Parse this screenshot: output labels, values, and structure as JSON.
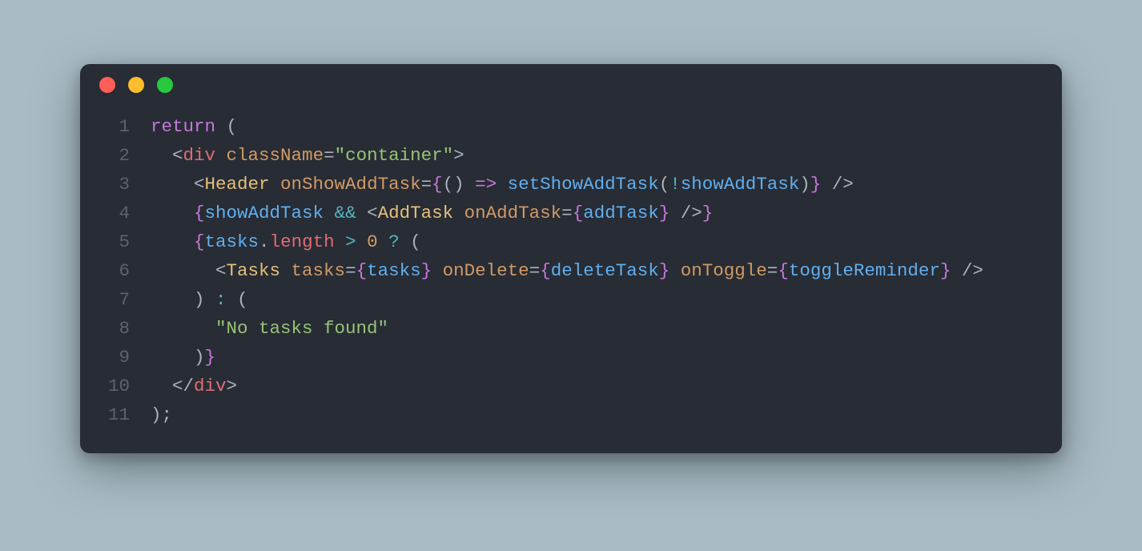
{
  "colors": {
    "page_bg": "#a9bcc6",
    "window_bg": "#282c34",
    "red": "#ff5f56",
    "yellow": "#ffbd2e",
    "green": "#27c93f"
  },
  "code": {
    "lines": [
      {
        "n": "1",
        "tokens": [
          {
            "cls": "tok-keyword",
            "t": "return"
          },
          {
            "cls": "tok-punct",
            "t": " ("
          }
        ]
      },
      {
        "n": "2",
        "tokens": [
          {
            "cls": "tok-punct",
            "t": "  <"
          },
          {
            "cls": "tok-tag",
            "t": "div"
          },
          {
            "cls": "tok-punct",
            "t": " "
          },
          {
            "cls": "tok-attr",
            "t": "className"
          },
          {
            "cls": "tok-punct",
            "t": "="
          },
          {
            "cls": "tok-string",
            "t": "\"container\""
          },
          {
            "cls": "tok-punct",
            "t": ">"
          }
        ]
      },
      {
        "n": "3",
        "tokens": [
          {
            "cls": "tok-punct",
            "t": "    <"
          },
          {
            "cls": "tok-comp",
            "t": "Header"
          },
          {
            "cls": "tok-punct",
            "t": " "
          },
          {
            "cls": "tok-attr",
            "t": "onShowAddTask"
          },
          {
            "cls": "tok-punct",
            "t": "="
          },
          {
            "cls": "tok-brace",
            "t": "{"
          },
          {
            "cls": "tok-punct",
            "t": "() "
          },
          {
            "cls": "tok-arrow",
            "t": "=>"
          },
          {
            "cls": "tok-punct",
            "t": " "
          },
          {
            "cls": "tok-func",
            "t": "setShowAddTask"
          },
          {
            "cls": "tok-punct",
            "t": "("
          },
          {
            "cls": "tok-op",
            "t": "!"
          },
          {
            "cls": "tok-var",
            "t": "showAddTask"
          },
          {
            "cls": "tok-punct",
            "t": ")"
          },
          {
            "cls": "tok-brace",
            "t": "}"
          },
          {
            "cls": "tok-punct",
            "t": " />"
          }
        ]
      },
      {
        "n": "4",
        "tokens": [
          {
            "cls": "tok-punct",
            "t": "    "
          },
          {
            "cls": "tok-brace",
            "t": "{"
          },
          {
            "cls": "tok-var",
            "t": "showAddTask"
          },
          {
            "cls": "tok-punct",
            "t": " "
          },
          {
            "cls": "tok-op",
            "t": "&&"
          },
          {
            "cls": "tok-punct",
            "t": " <"
          },
          {
            "cls": "tok-comp",
            "t": "AddTask"
          },
          {
            "cls": "tok-punct",
            "t": " "
          },
          {
            "cls": "tok-attr",
            "t": "onAddTask"
          },
          {
            "cls": "tok-punct",
            "t": "="
          },
          {
            "cls": "tok-brace",
            "t": "{"
          },
          {
            "cls": "tok-var",
            "t": "addTask"
          },
          {
            "cls": "tok-brace",
            "t": "}"
          },
          {
            "cls": "tok-punct",
            "t": " />"
          },
          {
            "cls": "tok-brace",
            "t": "}"
          }
        ]
      },
      {
        "n": "5",
        "tokens": [
          {
            "cls": "tok-punct",
            "t": "    "
          },
          {
            "cls": "tok-brace",
            "t": "{"
          },
          {
            "cls": "tok-var",
            "t": "tasks"
          },
          {
            "cls": "tok-punct",
            "t": "."
          },
          {
            "cls": "tok-prop",
            "t": "length"
          },
          {
            "cls": "tok-punct",
            "t": " "
          },
          {
            "cls": "tok-op",
            "t": ">"
          },
          {
            "cls": "tok-punct",
            "t": " "
          },
          {
            "cls": "tok-num",
            "t": "0"
          },
          {
            "cls": "tok-punct",
            "t": " "
          },
          {
            "cls": "tok-op",
            "t": "?"
          },
          {
            "cls": "tok-punct",
            "t": " ("
          }
        ]
      },
      {
        "n": "6",
        "tokens": [
          {
            "cls": "tok-punct",
            "t": "      <"
          },
          {
            "cls": "tok-comp",
            "t": "Tasks"
          },
          {
            "cls": "tok-punct",
            "t": " "
          },
          {
            "cls": "tok-attr",
            "t": "tasks"
          },
          {
            "cls": "tok-punct",
            "t": "="
          },
          {
            "cls": "tok-brace",
            "t": "{"
          },
          {
            "cls": "tok-var",
            "t": "tasks"
          },
          {
            "cls": "tok-brace",
            "t": "}"
          },
          {
            "cls": "tok-punct",
            "t": " "
          },
          {
            "cls": "tok-attr",
            "t": "onDelete"
          },
          {
            "cls": "tok-punct",
            "t": "="
          },
          {
            "cls": "tok-brace",
            "t": "{"
          },
          {
            "cls": "tok-var",
            "t": "deleteTask"
          },
          {
            "cls": "tok-brace",
            "t": "}"
          },
          {
            "cls": "tok-punct",
            "t": " "
          },
          {
            "cls": "tok-attr",
            "t": "onToggle"
          },
          {
            "cls": "tok-punct",
            "t": "="
          },
          {
            "cls": "tok-brace",
            "t": "{"
          },
          {
            "cls": "tok-var",
            "t": "toggleReminder"
          },
          {
            "cls": "tok-brace",
            "t": "}"
          },
          {
            "cls": "tok-punct",
            "t": " />"
          }
        ]
      },
      {
        "n": "7",
        "tokens": [
          {
            "cls": "tok-punct",
            "t": "    ) "
          },
          {
            "cls": "tok-op",
            "t": ":"
          },
          {
            "cls": "tok-punct",
            "t": " ("
          }
        ]
      },
      {
        "n": "8",
        "tokens": [
          {
            "cls": "tok-punct",
            "t": "      "
          },
          {
            "cls": "tok-string",
            "t": "\"No tasks found\""
          }
        ]
      },
      {
        "n": "9",
        "tokens": [
          {
            "cls": "tok-punct",
            "t": "    )"
          },
          {
            "cls": "tok-brace",
            "t": "}"
          }
        ]
      },
      {
        "n": "10",
        "tokens": [
          {
            "cls": "tok-punct",
            "t": "  </"
          },
          {
            "cls": "tok-tag",
            "t": "div"
          },
          {
            "cls": "tok-punct",
            "t": ">"
          }
        ]
      },
      {
        "n": "11",
        "tokens": [
          {
            "cls": "tok-punct",
            "t": ");"
          }
        ]
      }
    ]
  }
}
